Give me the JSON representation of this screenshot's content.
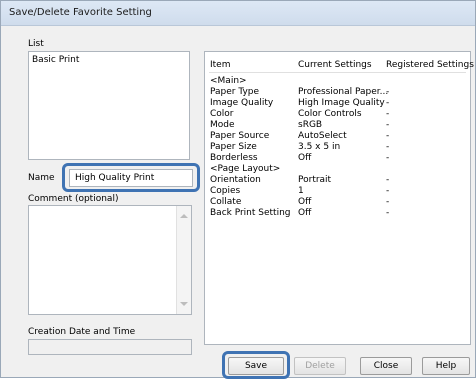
{
  "window": {
    "title": "Save/Delete Favorite Setting"
  },
  "list": {
    "label": "List",
    "items": [
      "Basic Print"
    ]
  },
  "name": {
    "label": "Name",
    "value": "High Quality Print"
  },
  "comment": {
    "label": "Comment (optional)",
    "value": ""
  },
  "creation": {
    "label": "Creation Date and Time",
    "value": ""
  },
  "table": {
    "headers": [
      "Item",
      "Current Settings",
      "Registered Settings"
    ],
    "rows": [
      {
        "item": "<Main>",
        "current": "",
        "registered": ""
      },
      {
        "item": "Paper Type",
        "current": "Professional Paper...",
        "registered": "-"
      },
      {
        "item": "Image Quality",
        "current": "High Image Quality",
        "registered": "-"
      },
      {
        "item": "Color",
        "current": "Color Controls",
        "registered": "-"
      },
      {
        "item": "Mode",
        "current": "sRGB",
        "registered": "-"
      },
      {
        "item": "Paper Source",
        "current": "AutoSelect",
        "registered": "-"
      },
      {
        "item": "Paper Size",
        "current": "3.5 x 5 in",
        "registered": "-"
      },
      {
        "item": "Borderless",
        "current": "Off",
        "registered": "-"
      },
      {
        "item": "<Page Layout>",
        "current": "",
        "registered": ""
      },
      {
        "item": "Orientation",
        "current": "Portrait",
        "registered": "-"
      },
      {
        "item": "Copies",
        "current": "1",
        "registered": "-"
      },
      {
        "item": "Collate",
        "current": "Off",
        "registered": "-"
      },
      {
        "item": "Back Print Setting",
        "current": "Off",
        "registered": "-"
      }
    ]
  },
  "buttons": {
    "save": "Save",
    "delete": "Delete",
    "close": "Close",
    "help": "Help"
  },
  "colors": {
    "highlight": "#3f73b3"
  }
}
